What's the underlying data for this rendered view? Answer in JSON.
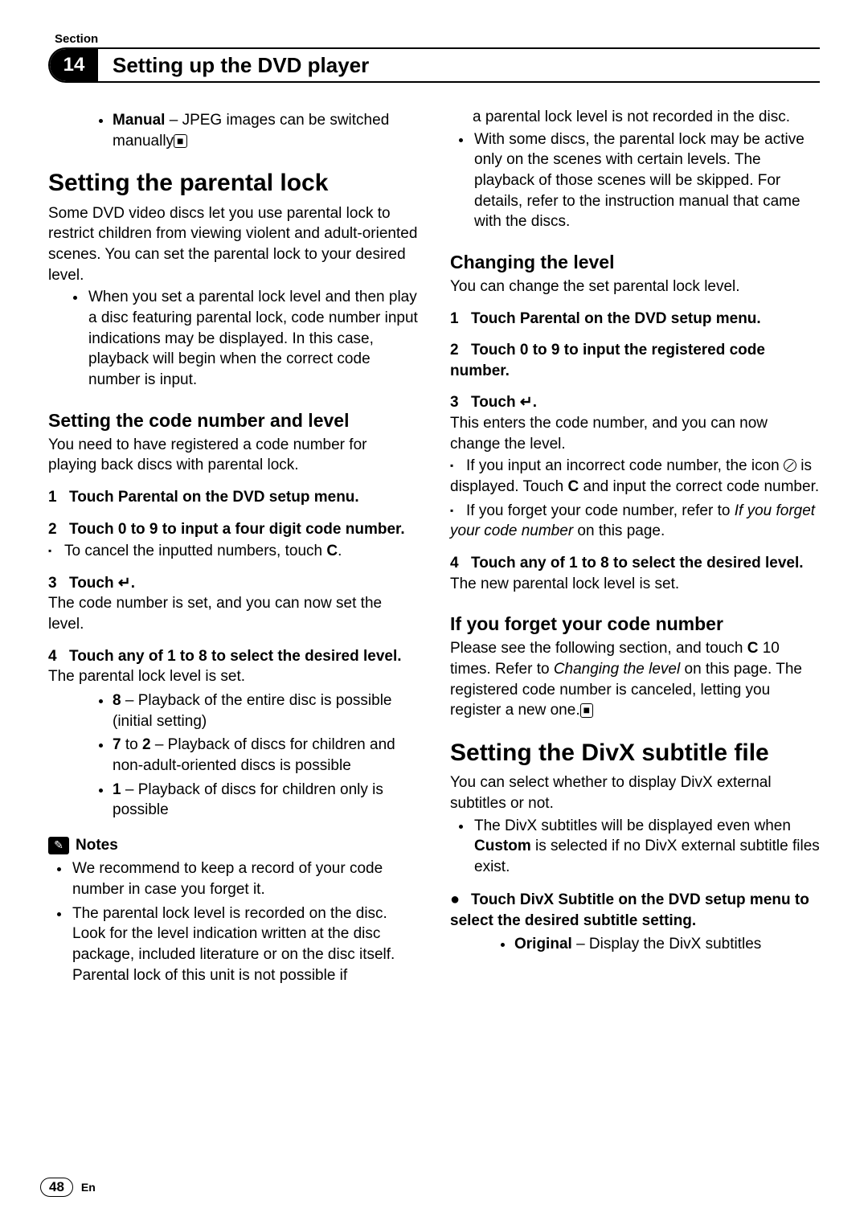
{
  "header": {
    "section_label": "Section",
    "number": "14",
    "title": "Setting up the DVD player"
  },
  "left": {
    "manual_bullet_bold": "Manual",
    "manual_bullet_rest": " – JPEG images can be switched manually",
    "h1_parental": "Setting the parental lock",
    "parental_intro": "Some DVD video discs let you use parental lock to restrict children from viewing violent and adult-oriented scenes. You can set the parental lock to your desired level.",
    "parental_bullet": "When you set a parental lock level and then play a disc featuring parental lock, code number input indications may be displayed. In this case, playback will begin when the correct code number is input.",
    "h2_code": "Setting the code number and level",
    "code_intro": "You need to have registered a code number for playing back discs with parental lock.",
    "step1": "Touch Parental on the DVD setup menu.",
    "step2": "Touch 0 to 9 to input a four digit code number.",
    "step2_sub_pre": "To cancel the inputted numbers, touch ",
    "step2_sub_bold": "C",
    "step2_sub_post": ".",
    "step3_pre": "Touch ",
    "step3_post": ".",
    "step3_body": "The code number is set, and you can now set the level.",
    "step4": "Touch any of 1 to 8 to select the desired level.",
    "step4_body": "The parental lock level is set.",
    "lvl8_b": "8",
    "lvl8_r": " – Playback of the entire disc is possible (initial setting)",
    "lvl72_b": "7",
    "lvl72_mid": " to ",
    "lvl72_b2": "2",
    "lvl72_r": " – Playback of discs for children and non-adult-oriented discs is possible",
    "lvl1_b": "1",
    "lvl1_r": " – Playback of discs for children only is possible",
    "notes_label": "Notes",
    "note1": "We recommend to keep a record of your code number in case you forget it.",
    "note2": "The parental lock level is recorded on the disc. Look for the level indication written at the disc package, included literature or on the disc itself. Parental lock of this unit is not possible if"
  },
  "right": {
    "cont1": "a parental lock level is not recorded in the disc.",
    "cont2": "With some discs, the parental lock may be active only on the scenes with certain levels. The playback of those scenes will be skipped. For details, refer to the instruction manual that came with the discs.",
    "h2_change": "Changing the level",
    "change_intro": "You can change the set parental lock level.",
    "cstep1": "Touch Parental on the DVD setup menu.",
    "cstep2": "Touch 0 to 9 to input the registered code number.",
    "cstep3_pre": "Touch ",
    "cstep3_post": ".",
    "cstep3_body": "This enters the code number, and you can now change the level.",
    "csub1_pre": "If you input an incorrect code number, the icon ",
    "csub1_mid": " is displayed. Touch ",
    "csub1_bold": "C",
    "csub1_post": " and input the correct code number.",
    "csub2_pre": "If you forget your code number, refer to ",
    "csub2_ital": "If you forget your code number",
    "csub2_post": " on this page.",
    "cstep4": "Touch any of 1 to 8 to select the desired level.",
    "cstep4_body": "The new parental lock level is set.",
    "h2_forget": "If you forget your code number",
    "forget_pre": "Please see the following section, and touch ",
    "forget_bold": "C",
    "forget_mid": " 10 times. Refer to ",
    "forget_ital": "Changing the level",
    "forget_post": " on this page. The registered code number is canceled, letting you register a new one.",
    "h1_divx": "Setting the DivX subtitle file",
    "divx_intro": "You can select whether to display DivX external subtitles or not.",
    "divx_b_pre": "The DivX subtitles will be displayed even when ",
    "divx_b_bold": "Custom",
    "divx_b_post": " is selected if no DivX external subtitle files exist.",
    "divx_step": "Touch DivX Subtitle on the DVD setup menu to select the desired subtitle setting.",
    "divx_opt_b": "Original",
    "divx_opt_r": " – Display the DivX subtitles"
  },
  "footer": {
    "page": "48",
    "lang": "En"
  }
}
